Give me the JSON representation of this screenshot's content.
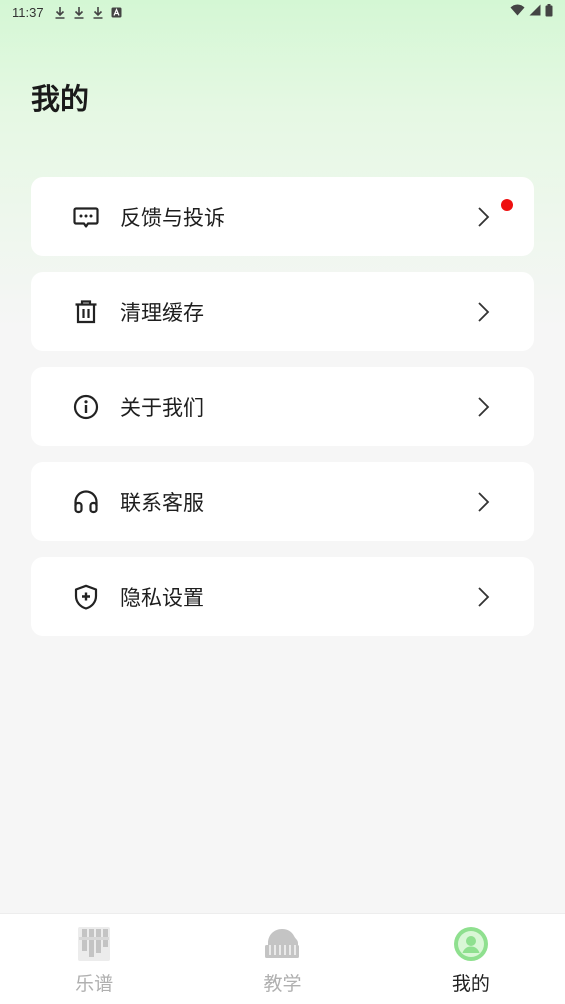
{
  "status_bar": {
    "time": "11:37"
  },
  "page": {
    "title": "我的"
  },
  "menu": {
    "items": [
      {
        "label": "反馈与投诉",
        "icon": "message-dots-icon",
        "badge": true
      },
      {
        "label": "清理缓存",
        "icon": "trash-icon",
        "badge": false
      },
      {
        "label": "关于我们",
        "icon": "info-icon",
        "badge": false
      },
      {
        "label": "联系客服",
        "icon": "headphones-icon",
        "badge": false
      },
      {
        "label": "隐私设置",
        "icon": "shield-plus-icon",
        "badge": false
      }
    ]
  },
  "tabbar": {
    "tabs": [
      {
        "label": "乐谱",
        "icon": "score-icon",
        "active": false
      },
      {
        "label": "教学",
        "icon": "piano-icon",
        "active": false
      },
      {
        "label": "我的",
        "icon": "profile-icon",
        "active": true
      }
    ]
  },
  "colors": {
    "accent": "#8fe08f",
    "badge": "#ee1010",
    "inactive_tab": "#b0b0b0"
  }
}
